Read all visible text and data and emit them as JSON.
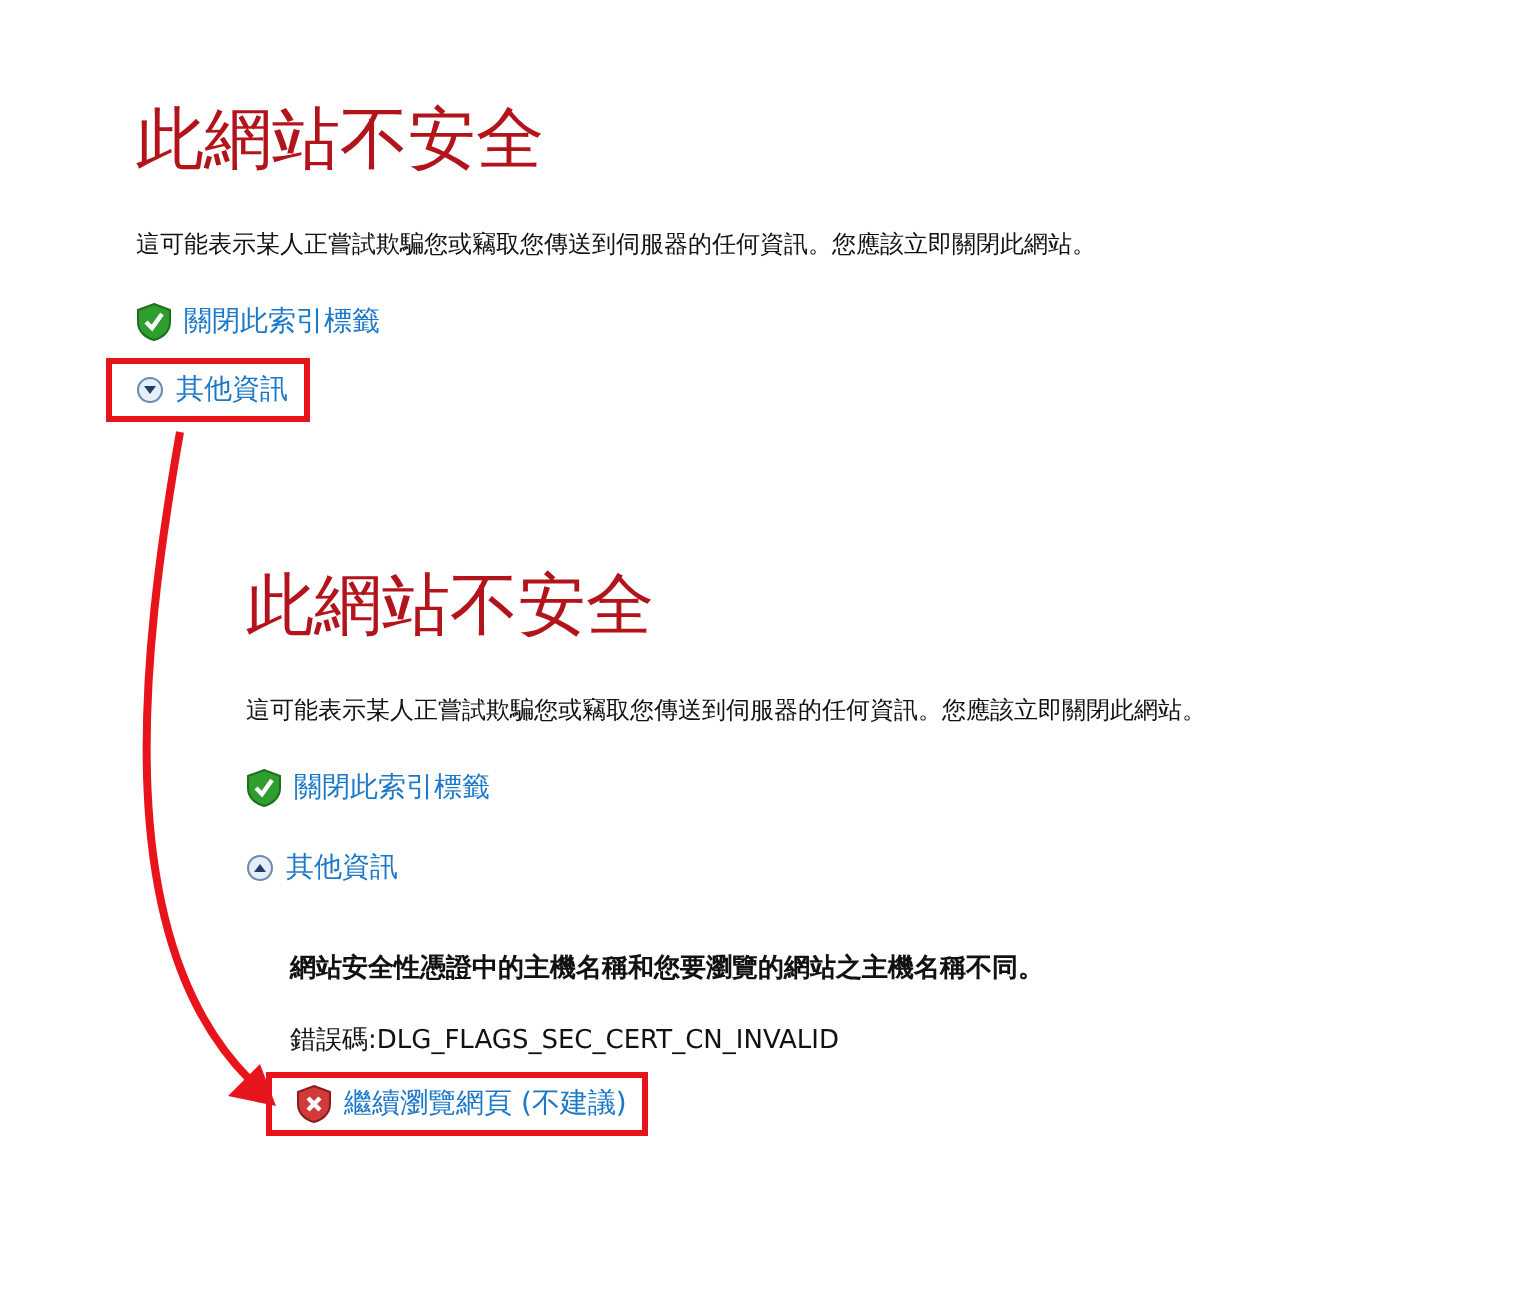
{
  "pages": [
    {
      "title": "此網站不安全",
      "message": "這可能表示某人正嘗試欺騙您或竊取您傳送到伺服器的任何資訊。您應該立即關閉此網站。",
      "close_link": "關閉此索引標籤",
      "more_info": {
        "label": "其他資訊",
        "expanded": false,
        "highlighted": true
      }
    },
    {
      "title": "此網站不安全",
      "message": "這可能表示某人正嘗試欺騙您或竊取您傳送到伺服器的任何資訊。您應該立即關閉此網站。",
      "close_link": "關閉此索引標籤",
      "more_info": {
        "label": "其他資訊",
        "expanded": true,
        "highlighted": false
      },
      "details": "網站安全性憑證中的主機名稱和您要瀏覽的網站之主機名稱不同。",
      "error_code": "錯誤碼:DLG_FLAGS_SEC_CERT_CN_INVALID",
      "continue_link": {
        "label": "繼續瀏覽網頁 (不建議)",
        "highlighted": true
      }
    }
  ]
}
